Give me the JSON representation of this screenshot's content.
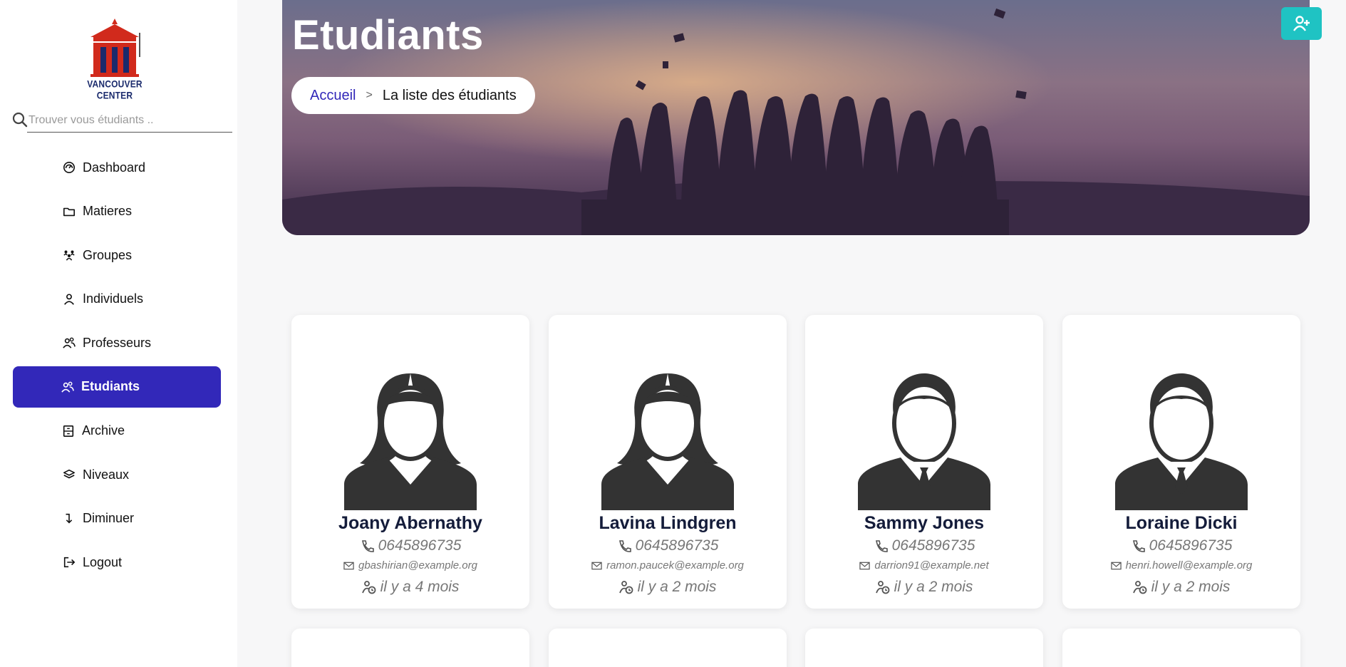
{
  "brand": {
    "name": "VANCOUVER CENTER",
    "logo_color": "#d12a1c",
    "logo_column_color": "#1a2a6c"
  },
  "search": {
    "placeholder": "Trouver vous étudiants .."
  },
  "sidebar": {
    "items": [
      {
        "label": "Dashboard",
        "icon": "dashboard-icon",
        "active": false
      },
      {
        "label": "Matieres",
        "icon": "folder-icon",
        "active": false
      },
      {
        "label": "Groupes",
        "icon": "group-icon",
        "active": false
      },
      {
        "label": "Individuels",
        "icon": "user-icon",
        "active": false
      },
      {
        "label": "Professeurs",
        "icon": "users-icon",
        "active": false
      },
      {
        "label": "Etudiants",
        "icon": "users-icon",
        "active": true
      },
      {
        "label": "Archive",
        "icon": "archive-icon",
        "active": false
      },
      {
        "label": "Niveaux",
        "icon": "layers-icon",
        "active": false
      },
      {
        "label": "Diminuer",
        "icon": "arrow-down-icon",
        "active": false
      },
      {
        "label": "Logout",
        "icon": "logout-icon",
        "active": false
      }
    ]
  },
  "hero": {
    "title": "Etudiants",
    "breadcrumb": {
      "home": "Accueil",
      "separator": ">",
      "current": "La liste des étudiants"
    }
  },
  "add_button": {
    "icon": "user-plus-icon",
    "color": "#1fc3c3"
  },
  "accent_color": "#3228b9",
  "students": [
    {
      "name": "Joany Abernathy",
      "phone": "0645896735",
      "email": "gbashirian@example.org",
      "time": "il y a 4 mois",
      "avatar": "female-avatar-icon"
    },
    {
      "name": "Lavina Lindgren",
      "phone": "0645896735",
      "email": "ramon.paucek@example.org",
      "time": "il y a 2 mois",
      "avatar": "female-avatar-icon"
    },
    {
      "name": "Sammy Jones",
      "phone": "0645896735",
      "email": "darrion91@example.net",
      "time": "il y a 2 mois",
      "avatar": "male-avatar-icon"
    },
    {
      "name": "Loraine Dicki",
      "phone": "0645896735",
      "email": "henri.howell@example.org",
      "time": "il y a 2 mois",
      "avatar": "male-avatar-icon"
    }
  ]
}
